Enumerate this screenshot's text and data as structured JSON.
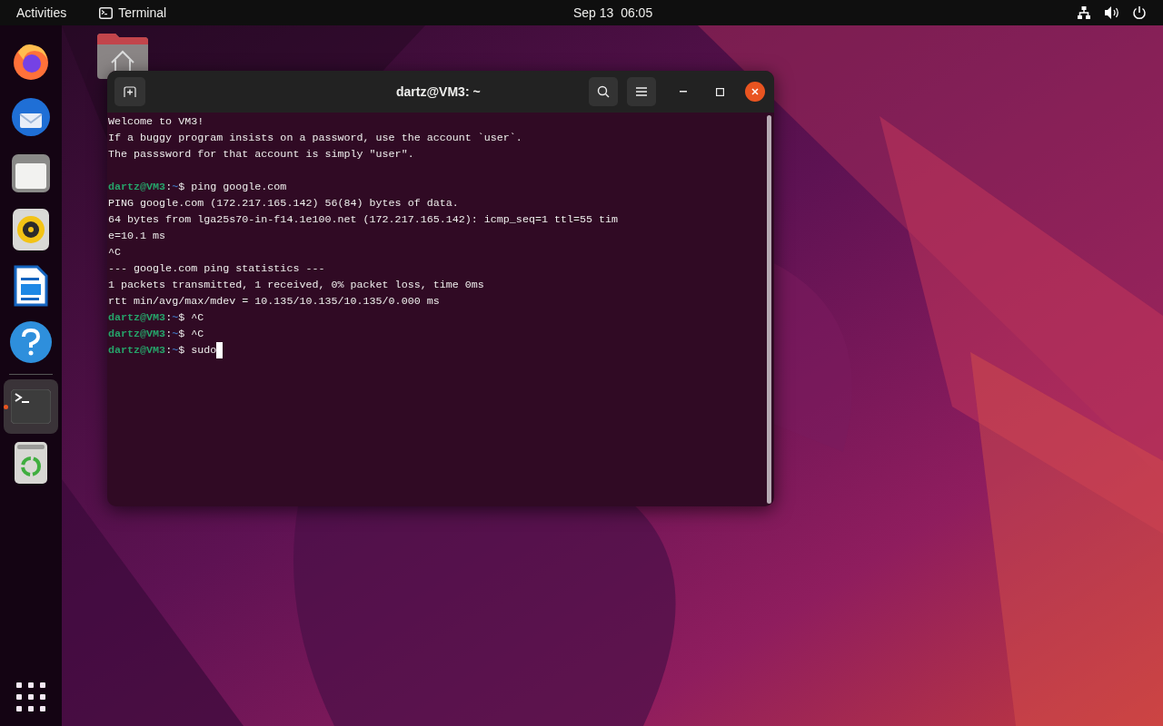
{
  "top_bar": {
    "activities": "Activities",
    "app_menu": "Terminal",
    "clock": "Sep 13  06:05"
  },
  "dock": [
    {
      "kind": "firefox",
      "selected": false,
      "running": false
    },
    {
      "kind": "thunderbird",
      "selected": false,
      "running": false
    },
    {
      "kind": "files",
      "selected": false,
      "running": false
    },
    {
      "kind": "rhythmbox",
      "selected": false,
      "running": false
    },
    {
      "kind": "writer",
      "selected": false,
      "running": false
    },
    {
      "kind": "help",
      "selected": false,
      "running": false
    },
    {
      "kind": "terminal",
      "selected": true,
      "running": true
    },
    {
      "kind": "trash",
      "selected": false,
      "running": false
    }
  ],
  "window": {
    "title": "dartz@VM3: ~",
    "lines": [
      {
        "kind": "output",
        "text": "Welcome to VM3!"
      },
      {
        "kind": "output",
        "text": "If a buggy program insists on a password, use the account `user`."
      },
      {
        "kind": "output",
        "text": "The passsword for that account is simply \"user\"."
      },
      {
        "kind": "blank"
      },
      {
        "kind": "prompt",
        "user": "dartz@VM3",
        "sep": ":",
        "path": "~",
        "symbol": "$",
        "command": "ping google.com",
        "cursor": false
      },
      {
        "kind": "output",
        "text": "PING google.com (172.217.165.142) 56(84) bytes of data."
      },
      {
        "kind": "output",
        "text": "64 bytes from lga25s70-in-f14.1e100.net (172.217.165.142): icmp_seq=1 ttl=55 tim"
      },
      {
        "kind": "output",
        "text": "e=10.1 ms"
      },
      {
        "kind": "output",
        "text": "^C"
      },
      {
        "kind": "output",
        "text": "--- google.com ping statistics ---"
      },
      {
        "kind": "output",
        "text": "1 packets transmitted, 1 received, 0% packet loss, time 0ms"
      },
      {
        "kind": "output",
        "text": "rtt min/avg/max/mdev = 10.135/10.135/10.135/0.000 ms"
      },
      {
        "kind": "prompt",
        "user": "dartz@VM3",
        "sep": ":",
        "path": "~",
        "symbol": "$",
        "command": "^C",
        "cursor": false
      },
      {
        "kind": "prompt",
        "user": "dartz@VM3",
        "sep": ":",
        "path": "~",
        "symbol": "$",
        "command": "^C",
        "cursor": false
      },
      {
        "kind": "prompt",
        "user": "dartz@VM3",
        "sep": ":",
        "path": "~",
        "symbol": "$",
        "command": "sudo",
        "cursor": true
      }
    ]
  }
}
